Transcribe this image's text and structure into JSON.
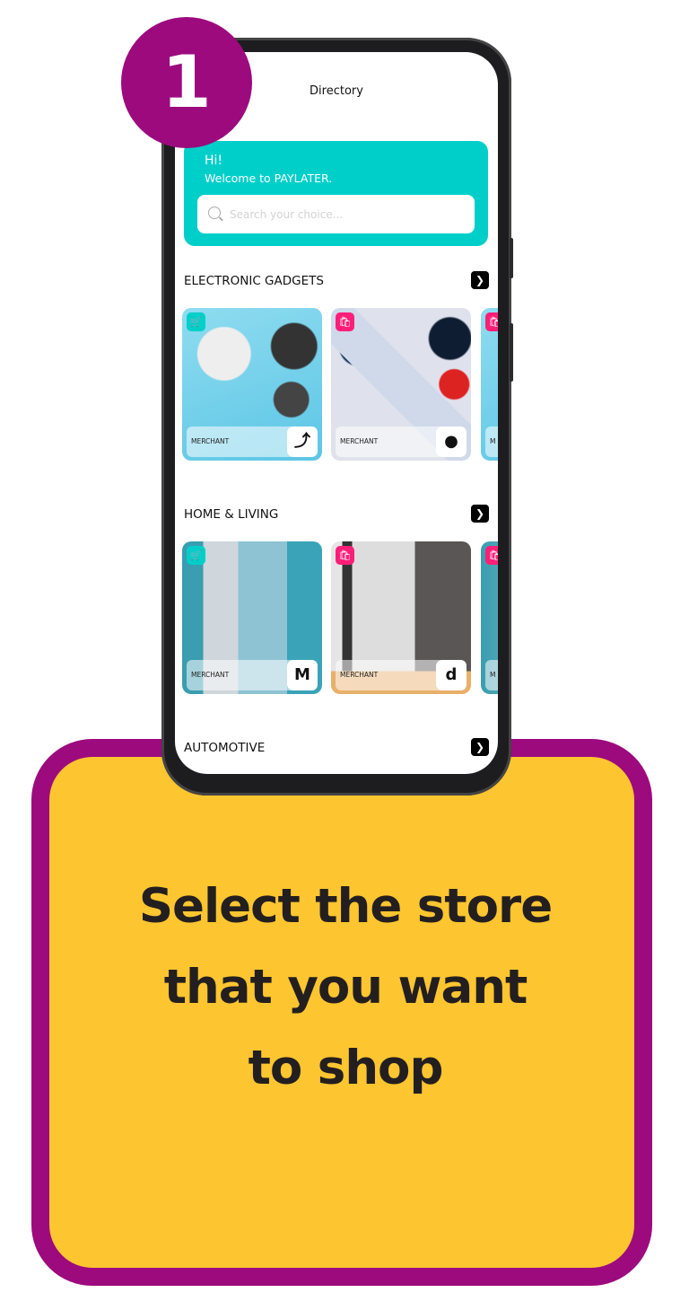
{
  "step_number": "1",
  "caption": {
    "bold": "Select",
    "rest_line1": " the store",
    "line2": "that you want",
    "line3": "to shop"
  },
  "app": {
    "title": "Directory",
    "hero": {
      "greeting": "Hi!",
      "welcome": "Welcome to PAYLATER.",
      "search_placeholder": "Search your choice..."
    },
    "sections": [
      {
        "label": "ELECTRONIC GADGETS",
        "cards": [
          {
            "tag": "cart-icon",
            "merchant": "MERCHANT",
            "logo": "anteater-logo"
          },
          {
            "tag": "shopping-bag-icon",
            "merchant": "MERCHANT",
            "logo": "elephant-logo"
          },
          {
            "tag": "shopping-bag-icon",
            "merchant": "M"
          }
        ]
      },
      {
        "label": "HOME & LIVING",
        "cards": [
          {
            "tag": "cart-icon",
            "merchant": "MERCHANT",
            "logo": "M-logo"
          },
          {
            "tag": "shopping-bag-icon",
            "merchant": "MERCHANT",
            "logo": "d-logo"
          },
          {
            "tag": "shopping-bag-icon",
            "merchant": "M"
          }
        ]
      },
      {
        "label": "AUTOMOTIVE"
      }
    ]
  },
  "colors": {
    "purple": "#9C0A7E",
    "yellow": "#FDC52F",
    "teal": "#00CFC9",
    "pink": "#FF1E78"
  }
}
